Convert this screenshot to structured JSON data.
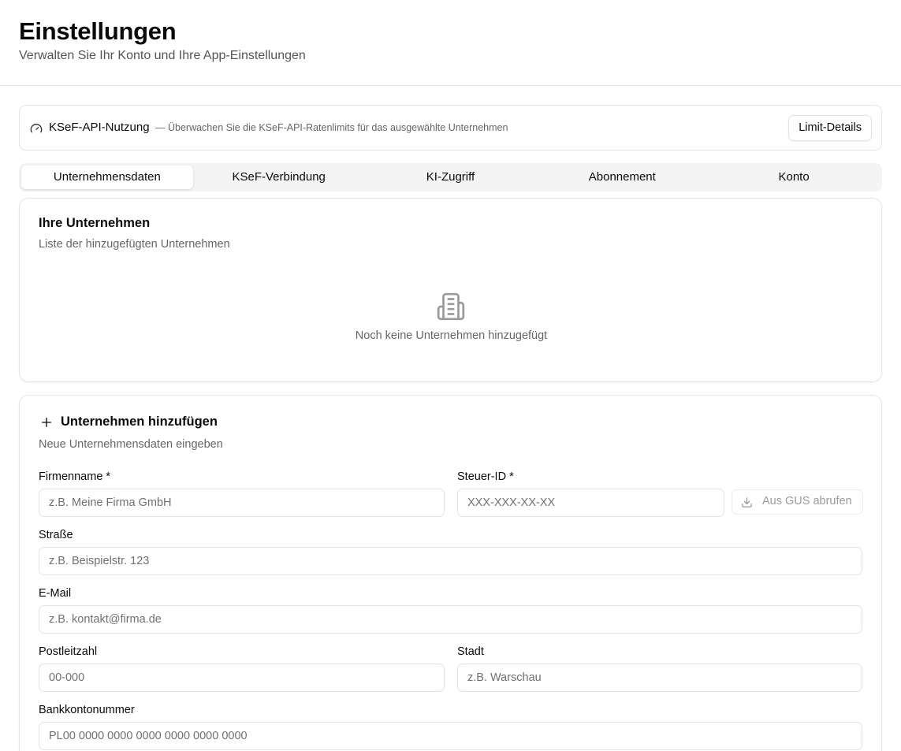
{
  "header": {
    "title": "Einstellungen",
    "subtitle": "Verwalten Sie Ihr Konto und Ihre App-Einstellungen"
  },
  "usage": {
    "icon": "gauge-icon",
    "title": "KSeF-API-Nutzung",
    "description": "— Überwachen Sie die KSeF-API-Ratenlimits für das ausgewählte Unternehmen",
    "button_label": "Limit-Details"
  },
  "tabs": [
    {
      "label": "Unternehmensdaten",
      "active": true
    },
    {
      "label": "KSeF-Verbindung",
      "active": false
    },
    {
      "label": "KI-Zugriff",
      "active": false
    },
    {
      "label": "Abonnement",
      "active": false
    },
    {
      "label": "Konto",
      "active": false
    }
  ],
  "companies": {
    "title": "Ihre Unternehmen",
    "description": "Liste der hinzugefügten Unternehmen",
    "empty_icon": "building-icon",
    "empty_text": "Noch keine Unternehmen hinzugefügt"
  },
  "add_company": {
    "icon": "plus-icon",
    "title": "Unternehmen hinzufügen",
    "description": "Neue Unternehmensdaten eingeben",
    "fields": {
      "company_name": {
        "label": "Firmenname *",
        "placeholder": "z.B. Meine Firma GmbH"
      },
      "tax_id": {
        "label": "Steuer-ID *",
        "placeholder": "XXX-XXX-XX-XX"
      },
      "street": {
        "label": "Straße",
        "placeholder": "z.B. Beispielstr. 123"
      },
      "email": {
        "label": "E-Mail",
        "placeholder": "z.B. kontakt@firma.de"
      },
      "postal_code": {
        "label": "Postleitzahl",
        "placeholder": "00-000"
      },
      "city": {
        "label": "Stadt",
        "placeholder": "z.B. Warschau"
      },
      "bank_account": {
        "label": "Bankkontonummer",
        "placeholder": "PL00 0000 0000 0000 0000 0000 0000"
      }
    },
    "gus_button": {
      "label": "Aus GUS abrufen",
      "icon": "download-icon"
    }
  }
}
